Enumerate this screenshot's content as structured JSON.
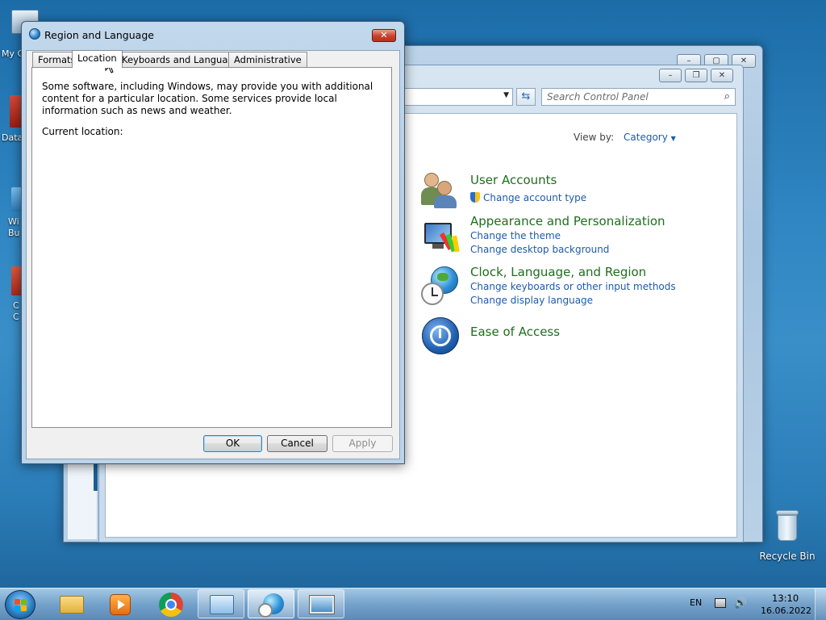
{
  "desktop": {
    "recycle_bin_label": "Recycle Bin"
  },
  "control_panel": {
    "search_placeholder": "Search Control Panel",
    "view_by_label": "View by:",
    "view_by_value": "Category",
    "categories": [
      {
        "title": "User Accounts",
        "links": [
          "Change account type"
        ],
        "icon": "users-icon"
      },
      {
        "title": "Appearance and Personalization",
        "links": [
          "Change the theme",
          "Change desktop background"
        ],
        "icon": "monitor-paint-icon"
      },
      {
        "title": "Clock, Language, and Region",
        "links": [
          "Change keyboards or other input methods",
          "Change display language"
        ],
        "icon": "globe-clock-icon"
      },
      {
        "title": "Ease of Access",
        "links": [],
        "icon": "ease-of-access-icon"
      }
    ]
  },
  "dialog": {
    "title": "Region and Language",
    "close_label": "✕",
    "tabs": [
      "Formats",
      "Location",
      "Keyboards and Languages",
      "Administrative"
    ],
    "active_tab": "Location",
    "description": "Some software, including Windows, may provide you with additional content for a particular location. Some services provide local information such as news and weather.",
    "current_location_label": "Current location:",
    "buttons": {
      "ok": "OK",
      "cancel": "Cancel",
      "apply": "Apply"
    }
  },
  "taskbar": {
    "language": "EN",
    "time": "13:10",
    "date": "16.06.2022",
    "items": [
      "file-explorer-icon",
      "media-player-icon",
      "chrome-icon",
      "control-panel-icon",
      "region-language-icon",
      "photo-viewer-icon"
    ]
  },
  "colors": {
    "category_title": "#1e6e1e",
    "link": "#1e5aa8",
    "desktop_bg": "#2f86c2"
  }
}
